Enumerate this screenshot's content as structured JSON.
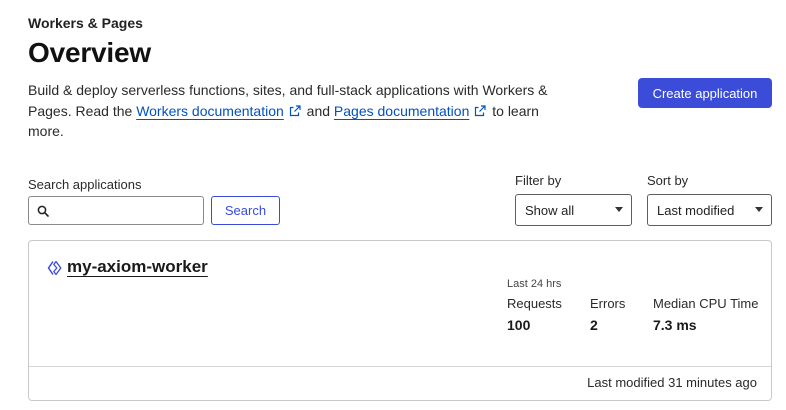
{
  "header": {
    "breadcrumb": "Workers & Pages",
    "title": "Overview",
    "description": {
      "part1": "Build & deploy serverless functions, sites, and full-stack applications with Workers & Pages. Read the ",
      "workers_link": "Workers documentation",
      "part2": " and ",
      "pages_link": "Pages documentation",
      "part3": " to learn more."
    },
    "create_button": "Create application"
  },
  "search": {
    "label": "Search applications",
    "value": "",
    "placeholder": "",
    "button": "Search"
  },
  "filter": {
    "label": "Filter by",
    "selected": "Show all"
  },
  "sort": {
    "label": "Sort by",
    "selected": "Last modified"
  },
  "workers": [
    {
      "name": "my-axiom-worker",
      "period": "Last 24 hrs",
      "metrics": [
        {
          "label": "Requests",
          "value": "100"
        },
        {
          "label": "Errors",
          "value": "2"
        },
        {
          "label": "Median CPU Time",
          "value": "7.3 ms"
        }
      ],
      "last_modified": "Last modified 31 minutes ago"
    }
  ],
  "colors": {
    "accent": "#3a4cd8",
    "link": "#0051c3"
  },
  "icons": {
    "external_link": "external-link-icon",
    "search": "search-icon",
    "caret": "chevron-down-icon",
    "worker": "worker-icon"
  }
}
